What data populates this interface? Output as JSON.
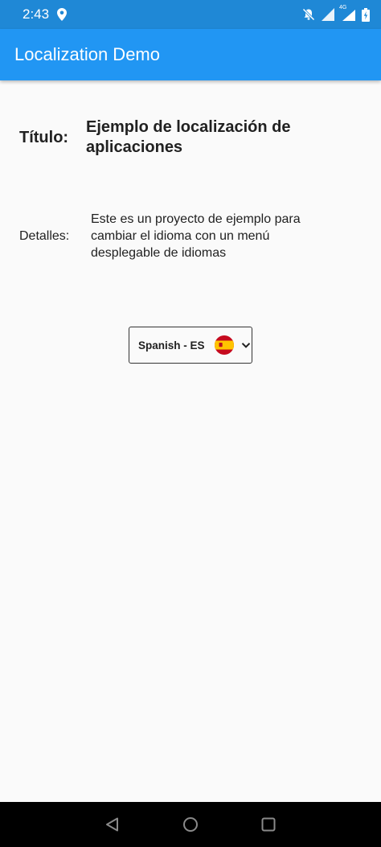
{
  "status_bar": {
    "time": "2:43",
    "network": "4G"
  },
  "app_bar": {
    "title": "Localization Demo"
  },
  "content": {
    "title_label": "Título:",
    "title_value": "Ejemplo de localización de aplicaciones",
    "details_label": "Detalles:",
    "details_value": "Este es un proyecto de ejemplo para cambiar el idioma con un menú desplegable de idiomas"
  },
  "language_dropdown": {
    "selected": "Spanish - ES",
    "flag_icon": "spain-flag-icon"
  },
  "colors": {
    "app_bar": "#2196f3",
    "status_bar": "#1f88d6",
    "background": "#fafafa",
    "nav_bar": "#000000"
  }
}
